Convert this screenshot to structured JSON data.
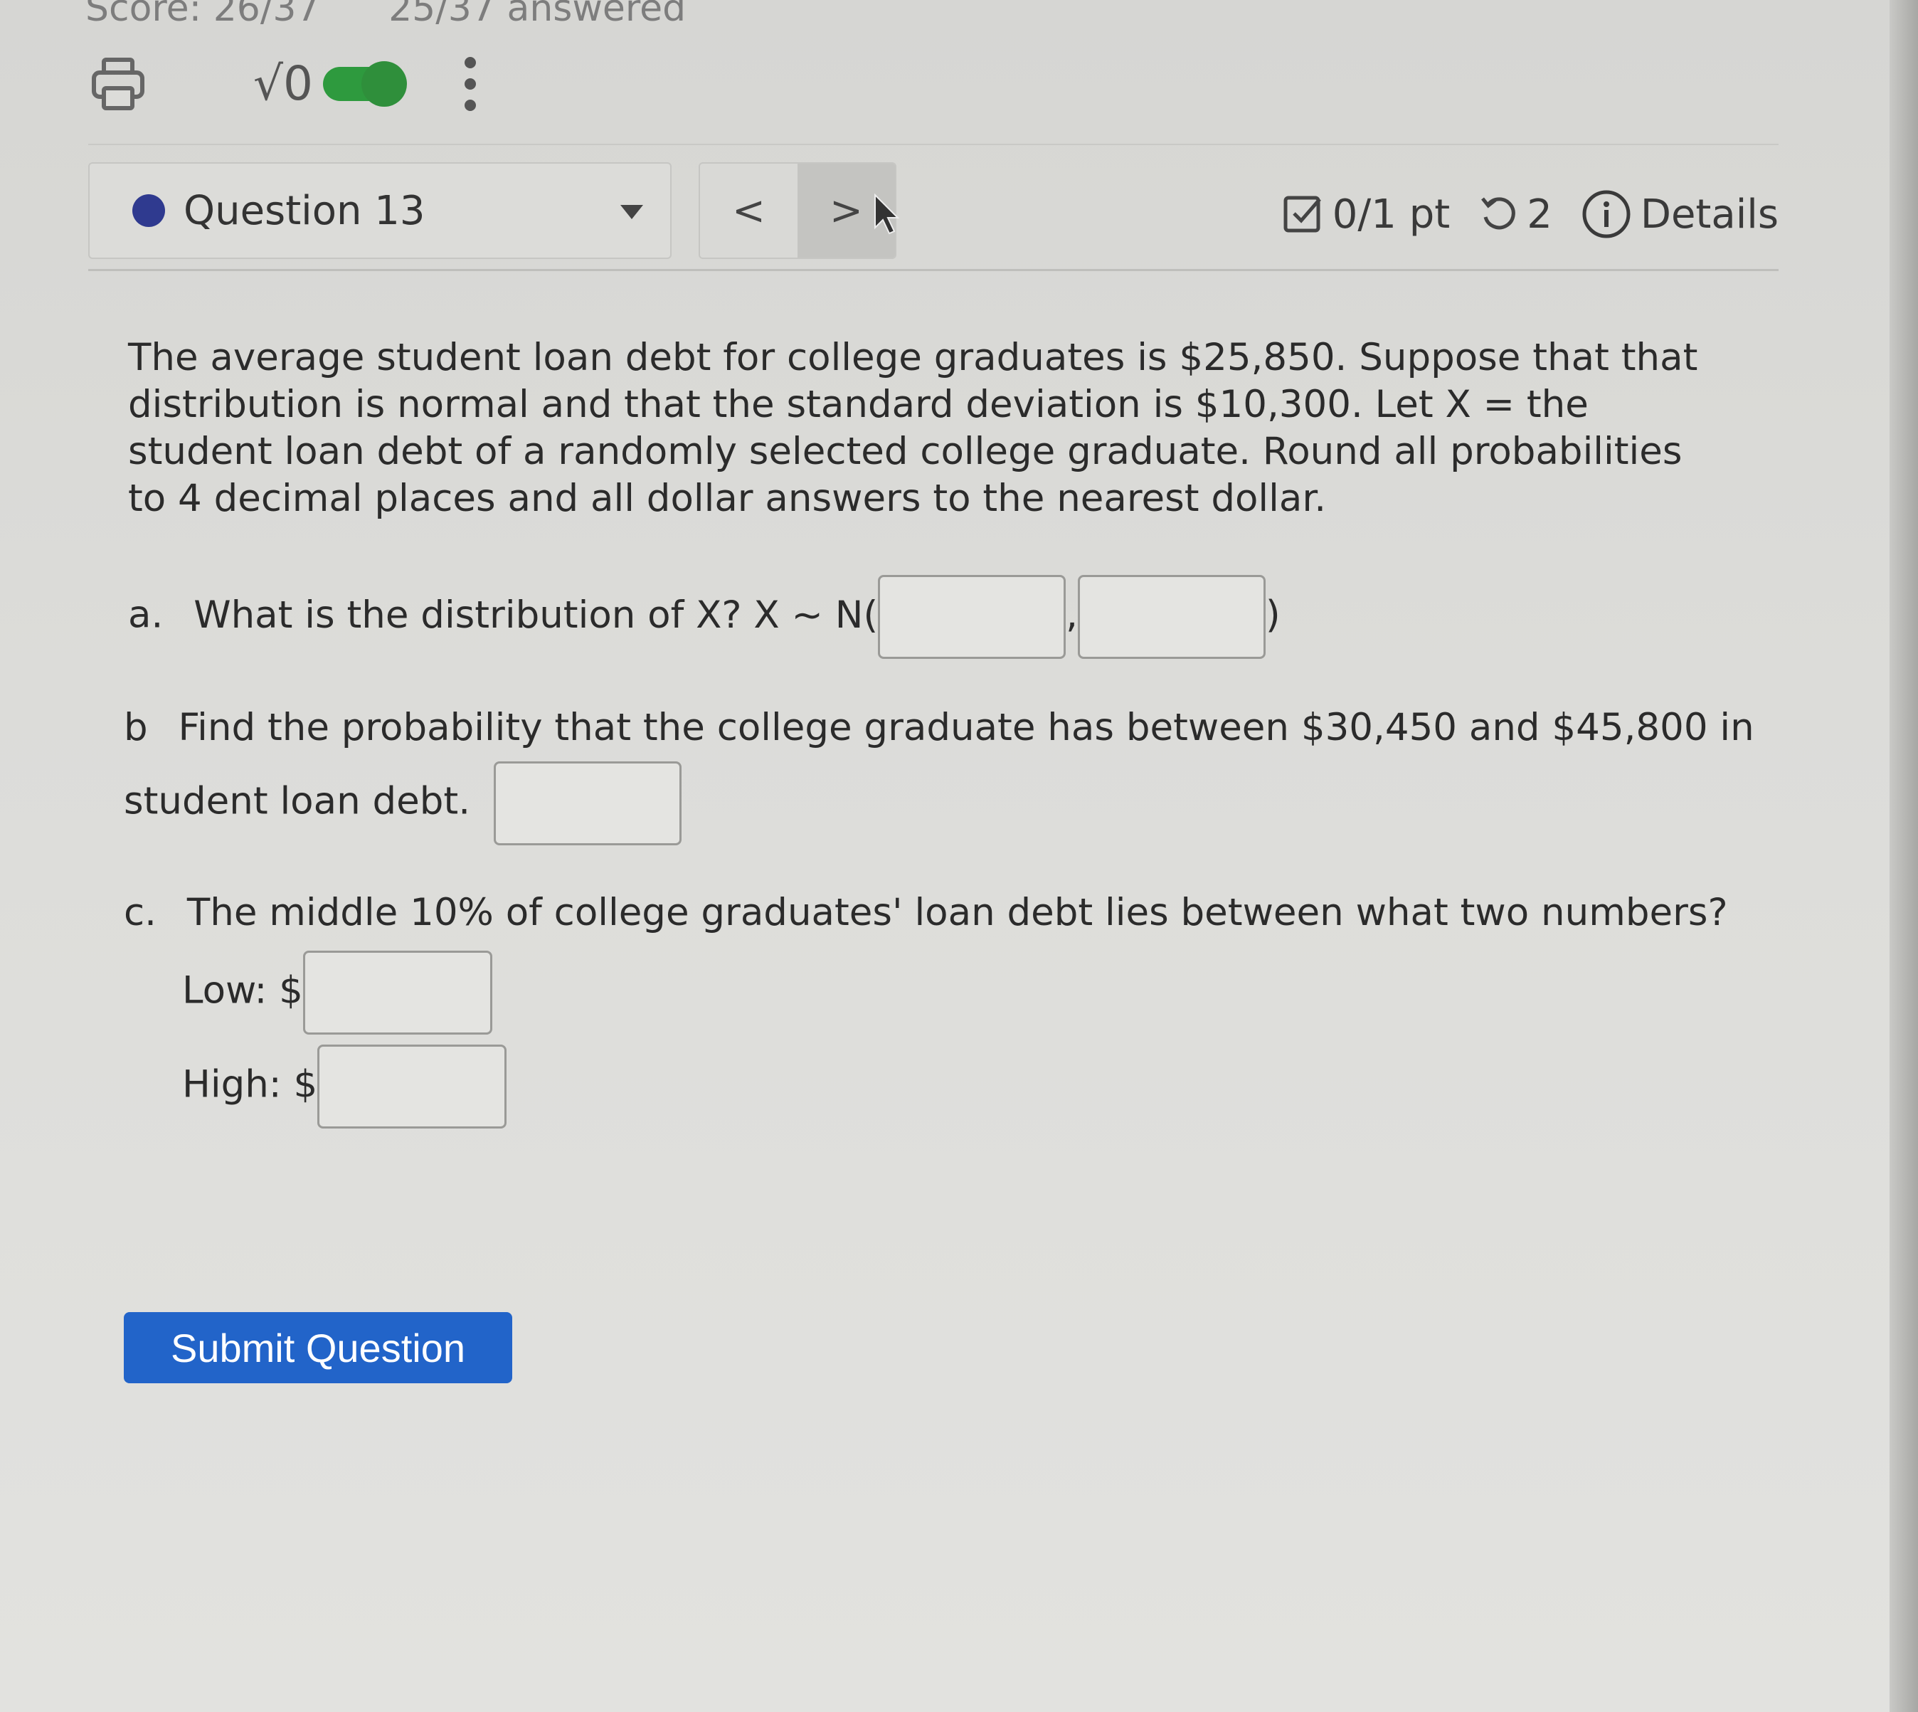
{
  "header": {
    "score": "Score: 26/37",
    "answered": "25/37 answered"
  },
  "toolbar": {
    "sqrt_label": "√0",
    "toggle_color": "#2e9a3e"
  },
  "question_nav": {
    "question_label": "Question 13",
    "prev_label": "<",
    "next_label": ">",
    "points": "0/1 pt",
    "retries": "2",
    "details_label": "Details"
  },
  "question": {
    "intro": "The average student loan debt for college graduates is $25,850. Suppose that that distribution is normal and that the standard deviation is $10,300. Let X = the student loan debt of a randomly selected college graduate. Round all probabilities to 4 decimal places and all dollar answers to the nearest dollar.",
    "part_a_prefix": "a.",
    "part_a_text": "What is the distribution of X? X ~ N(",
    "part_a_sep": ",",
    "part_a_close": ")",
    "part_b_prefix": "b",
    "part_b_line1": "Find the probability that the college graduate has between $30,450 and $45,800 in",
    "part_b_line2": "student loan debt.",
    "part_c_prefix": "c.",
    "part_c_text": "The middle 10% of college graduates' loan debt lies between what two numbers?",
    "low_label": "Low: $",
    "high_label": "High: $"
  },
  "submit_label": "Submit Question",
  "colors": {
    "accent": "#2264c9",
    "question_dot": "#2f3a8f"
  }
}
